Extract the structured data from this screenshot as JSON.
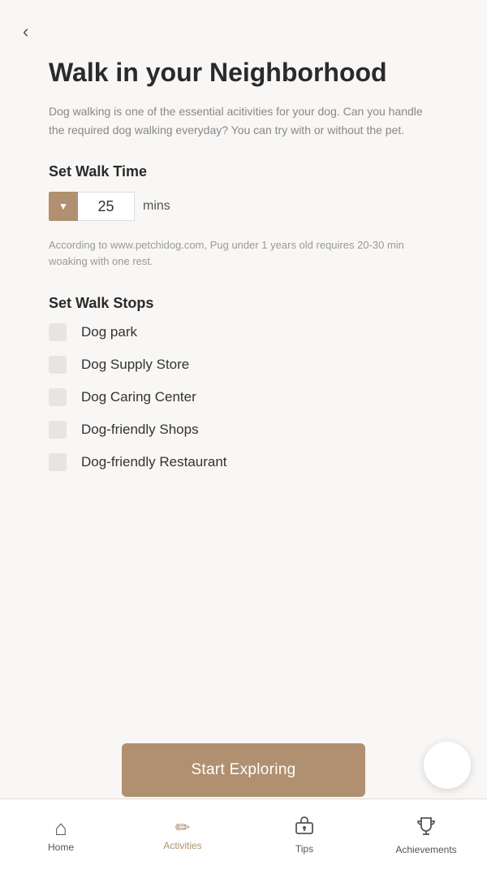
{
  "page": {
    "title": "Walk in your Neighborhood",
    "description": "Dog walking is one of the essential acitivities for your dog. Can you handle the required dog walking everyday? You can try with or without the pet.",
    "back_label": "‹"
  },
  "walk_time": {
    "section_label": "Set Walk Time",
    "value": "25",
    "unit": "mins",
    "info": "According to www.petchidog.com, Pug under 1 years old requires 20-30 min woaking with one rest."
  },
  "walk_stops": {
    "section_label": "Set Walk Stops",
    "items": [
      {
        "label": "Dog park"
      },
      {
        "label": "Dog Supply Store"
      },
      {
        "label": "Dog Caring Center"
      },
      {
        "label": "Dog-friendly Shops"
      },
      {
        "label": "Dog-friendly Restaurant"
      }
    ]
  },
  "cta": {
    "label": "Start Exploring"
  },
  "nav": {
    "items": [
      {
        "id": "home",
        "label": "Home",
        "icon": "⌂",
        "active": false
      },
      {
        "id": "activities",
        "label": "Activities",
        "icon": "✏",
        "active": true
      },
      {
        "id": "tips",
        "label": "Tips",
        "icon": "🧰",
        "active": false
      },
      {
        "id": "achievements",
        "label": "Achievements",
        "icon": "🏆",
        "active": false
      }
    ]
  }
}
